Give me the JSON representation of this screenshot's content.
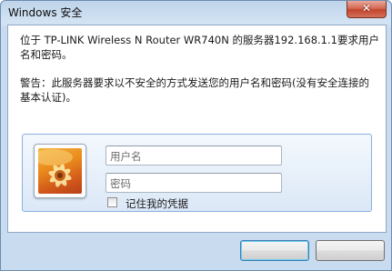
{
  "window": {
    "title": "Windows 安全",
    "close_glyph": "✕"
  },
  "message": {
    "line1": "位于 TP-LINK Wireless N Router WR740N 的服务器192.168.1.1要求用户名和密码。",
    "warning": "警告：此服务器要求以不安全的方式发送您的用户名和密码(没有安全连接的基本认证)。"
  },
  "credentials": {
    "avatar_icon": "user-tile-flower",
    "username_placeholder": "用户名",
    "password_placeholder": "密码",
    "remember_label": "记住我的凭据",
    "remember_checked": false
  },
  "buttons": {
    "ok_label": "",
    "cancel_label": ""
  },
  "colors": {
    "frame": "#c9dbef",
    "close": "#c2452c",
    "panel": "#dbe8f7"
  }
}
